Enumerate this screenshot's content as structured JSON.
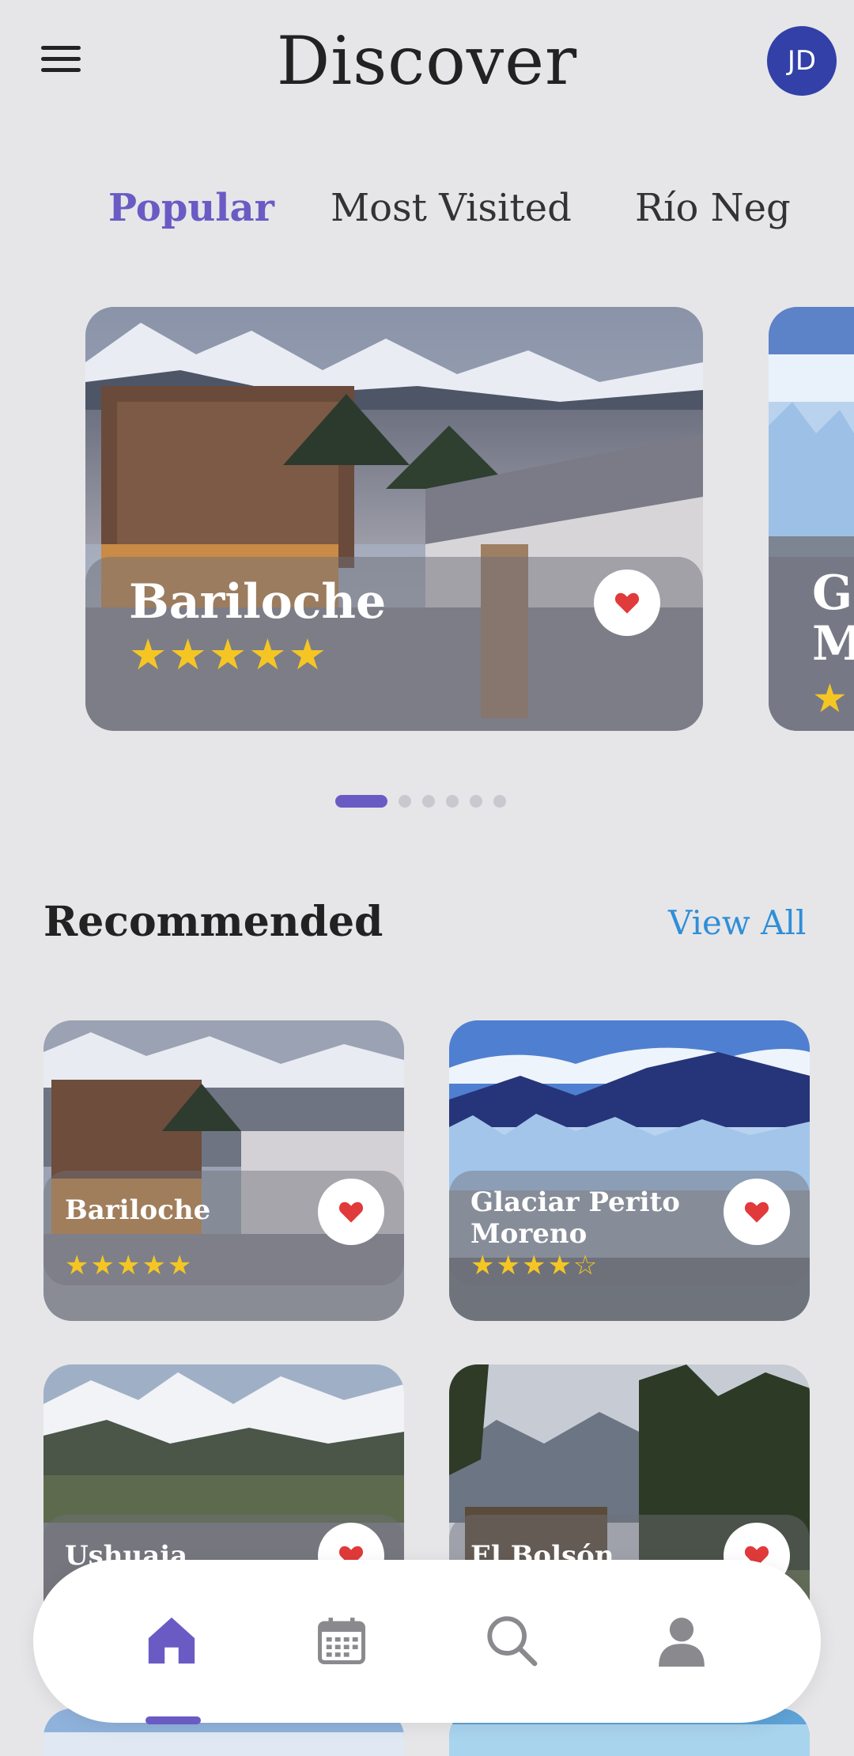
{
  "header": {
    "title": "Discover",
    "avatar_initials": "JD",
    "menu_icon": "hamburger-menu-icon"
  },
  "tabs": [
    {
      "label": "Popular",
      "active": true
    },
    {
      "label": "Most Visited",
      "active": false
    },
    {
      "label": "Río Negro",
      "active": false
    }
  ],
  "popular": [
    {
      "name": "Bariloche",
      "stars": "★★★★★",
      "rating": 5,
      "favorited": true
    },
    {
      "name": "Glaciar Perito Moreno",
      "name_visible": "Gl M",
      "stars": "★",
      "favorited": true
    }
  ],
  "carousel": {
    "pages": 6,
    "active_index": 0
  },
  "recommended": {
    "title": "Recommended",
    "view_all": "View All",
    "items": [
      {
        "name": "Bariloche",
        "stars": "★★★★★",
        "rating": 5
      },
      {
        "name": "Glaciar Perito Moreno",
        "stars": "★★★★☆",
        "rating": 4
      },
      {
        "name": "Ushuaia",
        "stars": ""
      },
      {
        "name": "El Bolsón",
        "stars": ""
      }
    ]
  },
  "bottom_nav": [
    {
      "icon": "home-icon",
      "active": true
    },
    {
      "icon": "calendar-icon",
      "active": false
    },
    {
      "icon": "search-icon",
      "active": false
    },
    {
      "icon": "profile-icon",
      "active": false
    }
  ],
  "colors": {
    "accent": "#6a5bc4",
    "link": "#2f8ed8",
    "star": "#f5c623",
    "heart": "#e03a3a",
    "avatar": "#3240a8",
    "background": "#e6e6e8"
  }
}
